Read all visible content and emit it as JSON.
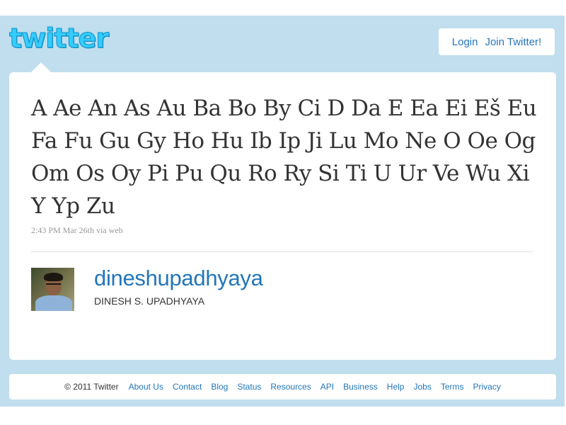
{
  "header": {
    "logo_text": "twitter",
    "login_label": "Login",
    "join_label": "Join Twitter!"
  },
  "tweet": {
    "text": "A Ae An As Au Ba Bo By Ci D Da E Ea Ei Eš Eu Fa Fu Gu Gy Ho Hu Ib Ip Ji Lu Mo Ne O Oe Og Om Os Oy Pi Pu Qu Ro Ry Si Ti U Ur Ve Wu Xi Y Yp Zu",
    "meta": "2:43 PM Mar 26th via web"
  },
  "author": {
    "username": "dineshupadhyaya",
    "full_name": "DINESH S. UPADHYAYA"
  },
  "footer": {
    "copyright": "© 2011 Twitter",
    "links": [
      "About Us",
      "Contact",
      "Blog",
      "Status",
      "Resources",
      "API",
      "Business",
      "Help",
      "Jobs",
      "Terms",
      "Privacy"
    ]
  },
  "colors": {
    "background": "#c0deed",
    "link": "#2276bb",
    "logo": "#33ccff"
  }
}
